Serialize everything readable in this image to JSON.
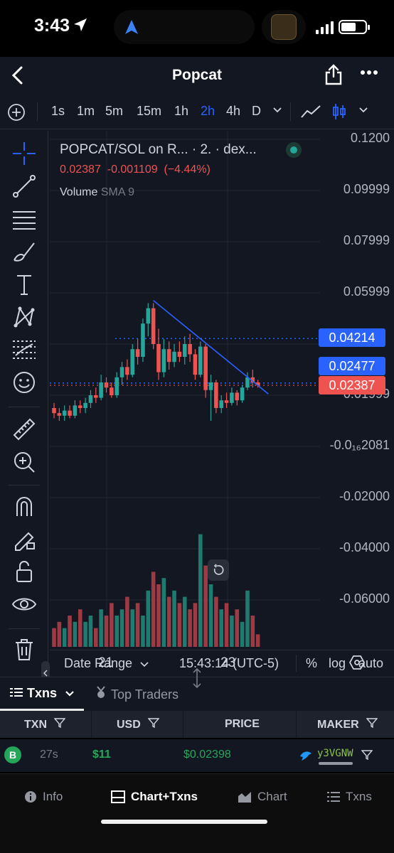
{
  "status_bar": {
    "time": "3:43"
  },
  "header": {
    "title": "Popcat"
  },
  "timeframes": [
    "1s",
    "1m",
    "5m",
    "15m",
    "1h",
    "2h",
    "4h",
    "D"
  ],
  "active_timeframe": "2h",
  "legend": {
    "title": "POPCAT/SOL on R... · 2. · dex...",
    "price": "0.02387",
    "change": "-0.001109",
    "change_pct": "(−4.44%)",
    "volume_label": "Volume",
    "volume_sma": "SMA 9"
  },
  "price_axis": [
    "0.1200",
    "0.09999",
    "0.07999",
    "0.05999",
    "0.01999",
    "-0.0₁₆2081",
    "-0.02000",
    "-0.04000",
    "-0.06000"
  ],
  "price_tags": [
    {
      "label": "0.04214",
      "color": "#2962ff"
    },
    {
      "label": "0.02477",
      "color": "#2962ff"
    },
    {
      "label": "0.02387",
      "color": "#ef5350"
    }
  ],
  "x_axis": [
    "21",
    "23"
  ],
  "chart_bottom": {
    "date_range": "Date Range",
    "clock": "15:43:14 (UTC-5)",
    "percent": "%",
    "log": "log",
    "auto": "auto"
  },
  "txn_tabs": {
    "txns": "Txns",
    "top_traders": "Top Traders"
  },
  "table": {
    "headers": [
      "TXN",
      "USD",
      "PRICE",
      "MAKER"
    ],
    "rows": [
      {
        "type": "B",
        "age": "27s",
        "usd": "$11",
        "price": "$0.02398",
        "maker": "y3VGNW"
      }
    ]
  },
  "bottom_nav": [
    "Info",
    "Chart+Txns",
    "Chart",
    "Txns"
  ],
  "active_nav": "Chart+Txns",
  "colors": {
    "up": "#26a69a",
    "down": "#ef5350",
    "accent": "#2962ff",
    "background": "#131722"
  },
  "chart_data": {
    "type": "candlestick",
    "x_ticks": [
      "21",
      "23"
    ],
    "y_ticks": [
      "0.1200",
      "0.09999",
      "0.07999",
      "0.05999",
      "0.01999",
      "-0.0₁₆2081",
      "-0.02000",
      "-0.04000",
      "-0.06000"
    ],
    "last_price": 0.02387,
    "horizontal_lines": [
      0.04214,
      0.02477
    ],
    "candles": [
      {
        "o": 0.015,
        "h": 0.017,
        "l": 0.011,
        "c": 0.013
      },
      {
        "o": 0.013,
        "h": 0.015,
        "l": 0.01,
        "c": 0.012
      },
      {
        "o": 0.012,
        "h": 0.016,
        "l": 0.01,
        "c": 0.014
      },
      {
        "o": 0.014,
        "h": 0.016,
        "l": 0.011,
        "c": 0.012
      },
      {
        "o": 0.012,
        "h": 0.018,
        "l": 0.011,
        "c": 0.016
      },
      {
        "o": 0.016,
        "h": 0.018,
        "l": 0.013,
        "c": 0.015
      },
      {
        "o": 0.015,
        "h": 0.019,
        "l": 0.013,
        "c": 0.017
      },
      {
        "o": 0.017,
        "h": 0.022,
        "l": 0.015,
        "c": 0.02
      },
      {
        "o": 0.02,
        "h": 0.023,
        "l": 0.017,
        "c": 0.019
      },
      {
        "o": 0.019,
        "h": 0.028,
        "l": 0.018,
        "c": 0.025
      },
      {
        "o": 0.025,
        "h": 0.027,
        "l": 0.021,
        "c": 0.023
      },
      {
        "o": 0.023,
        "h": 0.025,
        "l": 0.019,
        "c": 0.02
      },
      {
        "o": 0.02,
        "h": 0.029,
        "l": 0.019,
        "c": 0.027
      },
      {
        "o": 0.027,
        "h": 0.033,
        "l": 0.024,
        "c": 0.031
      },
      {
        "o": 0.031,
        "h": 0.034,
        "l": 0.026,
        "c": 0.028
      },
      {
        "o": 0.028,
        "h": 0.04,
        "l": 0.027,
        "c": 0.038
      },
      {
        "o": 0.038,
        "h": 0.042,
        "l": 0.032,
        "c": 0.035
      },
      {
        "o": 0.035,
        "h": 0.05,
        "l": 0.033,
        "c": 0.048
      },
      {
        "o": 0.048,
        "h": 0.056,
        "l": 0.043,
        "c": 0.054
      },
      {
        "o": 0.054,
        "h": 0.056,
        "l": 0.038,
        "c": 0.04
      },
      {
        "o": 0.04,
        "h": 0.046,
        "l": 0.026,
        "c": 0.029
      },
      {
        "o": 0.029,
        "h": 0.042,
        "l": 0.027,
        "c": 0.038
      },
      {
        "o": 0.038,
        "h": 0.041,
        "l": 0.03,
        "c": 0.033
      },
      {
        "o": 0.033,
        "h": 0.04,
        "l": 0.031,
        "c": 0.037
      },
      {
        "o": 0.037,
        "h": 0.041,
        "l": 0.033,
        "c": 0.035
      },
      {
        "o": 0.035,
        "h": 0.043,
        "l": 0.032,
        "c": 0.04
      },
      {
        "o": 0.04,
        "h": 0.044,
        "l": 0.033,
        "c": 0.036
      },
      {
        "o": 0.036,
        "h": 0.038,
        "l": 0.026,
        "c": 0.028
      },
      {
        "o": 0.028,
        "h": 0.041,
        "l": 0.027,
        "c": 0.039
      },
      {
        "o": 0.039,
        "h": 0.04,
        "l": 0.019,
        "c": 0.022
      },
      {
        "o": 0.022,
        "h": 0.028,
        "l": 0.01,
        "c": 0.025
      },
      {
        "o": 0.025,
        "h": 0.026,
        "l": 0.013,
        "c": 0.015
      },
      {
        "o": 0.015,
        "h": 0.02,
        "l": 0.013,
        "c": 0.018
      },
      {
        "o": 0.018,
        "h": 0.021,
        "l": 0.015,
        "c": 0.017
      },
      {
        "o": 0.017,
        "h": 0.023,
        "l": 0.016,
        "c": 0.021
      },
      {
        "o": 0.021,
        "h": 0.022,
        "l": 0.016,
        "c": 0.018
      },
      {
        "o": 0.018,
        "h": 0.024,
        "l": 0.017,
        "c": 0.023
      },
      {
        "o": 0.023,
        "h": 0.029,
        "l": 0.022,
        "c": 0.027
      },
      {
        "o": 0.027,
        "h": 0.03,
        "l": 0.023,
        "c": 0.025
      },
      {
        "o": 0.025,
        "h": 0.026,
        "l": 0.023,
        "c": 0.0239
      }
    ],
    "volume": [
      3,
      4,
      3,
      5,
      4,
      6,
      4,
      5,
      3,
      6,
      5,
      7,
      5,
      6,
      8,
      6,
      7,
      5,
      9,
      12,
      10,
      11,
      8,
      9,
      7,
      8,
      6,
      7,
      18,
      13,
      10,
      8,
      6,
      7,
      5,
      6,
      4,
      9,
      5,
      2
    ],
    "volume_ylim": [
      0,
      20
    ],
    "trendline": {
      "from": [
        19,
        0.057
      ],
      "to": [
        41,
        0.0205
      ]
    }
  }
}
